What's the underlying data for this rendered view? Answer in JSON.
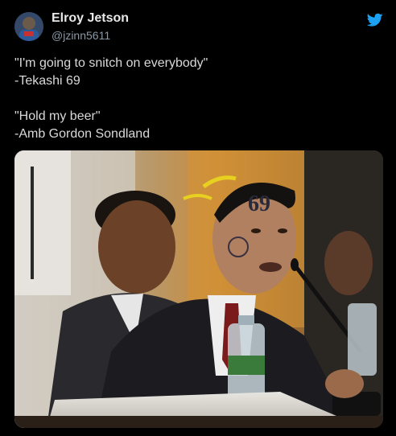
{
  "author": {
    "name": "Elroy Jetson",
    "handle": "@jzinn5611"
  },
  "tweet": {
    "lines": [
      "\"I'm going to snitch on everybody\"",
      "-Tekashi 69",
      "\"Hold my beer\"",
      "-Amb Gordon Sondland"
    ],
    "face_tattoo": "69"
  },
  "icons": {
    "platform": "twitter-bird-icon",
    "avatar": "avatar-image"
  },
  "colors": {
    "background": "#000000",
    "text": "#d9d9d9",
    "handle": "#8b98a5",
    "twitter_blue": "#1da1f2"
  }
}
